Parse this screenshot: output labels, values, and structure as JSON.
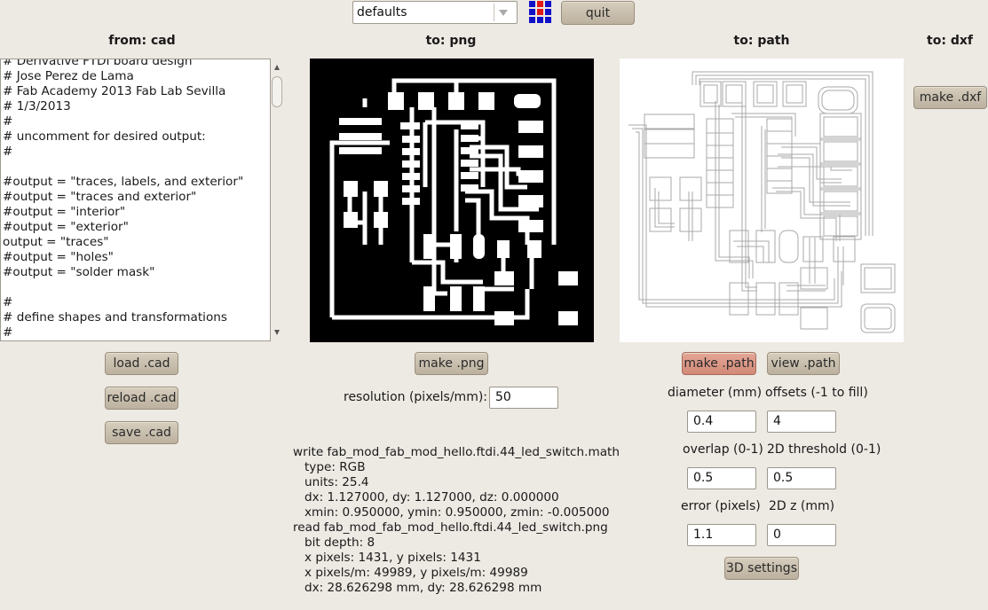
{
  "toolbar": {
    "defaults_value": "defaults",
    "quit_label": "quit",
    "logo_colors": [
      "#1010c8",
      "#e01818"
    ]
  },
  "columns": {
    "cad_header": "from: cad",
    "png_header": "to: png",
    "path_header": "to: path",
    "dxf_header": "to: dxf"
  },
  "cad": {
    "lines": [
      "# Derivative FTDI board design",
      "# Jose Perez de Lama",
      "# Fab Academy 2013 Fab Lab Sevilla",
      "# 1/3/2013",
      "#",
      "# uncomment for desired output:",
      "#",
      "",
      "#output = \"traces, labels, and exterior\"",
      "#output = \"traces and exterior\"",
      "#output = \"interior\"",
      "#output = \"exterior\"",
      "output = \"traces\"",
      "#output = \"holes\"",
      "#output = \"solder mask\"",
      "",
      "#",
      "# define shapes and transformations",
      "#"
    ],
    "load_label": "load .cad",
    "reload_label": "reload .cad",
    "save_label": "save .cad"
  },
  "png": {
    "make_label": "make .png",
    "resolution_label": "resolution (pixels/mm):",
    "resolution_value": "50"
  },
  "path": {
    "make_label": "make .path",
    "view_label": "view .path",
    "diameter_label": "diameter (mm)",
    "offsets_label": "offsets (-1 to fill)",
    "diameter_value": "0.4",
    "offsets_value": "4",
    "overlap_label": "overlap (0-1)",
    "threshold_label": "2D threshold (0-1)",
    "overlap_value": "0.5",
    "threshold_value": "0.5",
    "error_label": "error (pixels)",
    "z_label": "2D z (mm)",
    "error_value": "1.1",
    "z_value": "0",
    "settings3d_label": "3D settings"
  },
  "dxf": {
    "make_label": "make .dxf"
  },
  "log": {
    "lines": [
      "write fab_mod_fab_mod_hello.ftdi.44_led_switch.math",
      "   type: RGB",
      "   units: 25.4",
      "   dx: 1.127000, dy: 1.127000, dz: 0.000000",
      "   xmin: 0.950000, ymin: 0.950000, zmin: -0.005000",
      "read fab_mod_fab_mod_hello.ftdi.44_led_switch.png",
      "   bit depth: 8",
      "   x pixels: 1431, y pixels: 1431",
      "   x pixels/m: 49989, y pixels/m: 49989",
      "   dx: 28.626298 mm, dy: 28.626298 mm"
    ]
  }
}
